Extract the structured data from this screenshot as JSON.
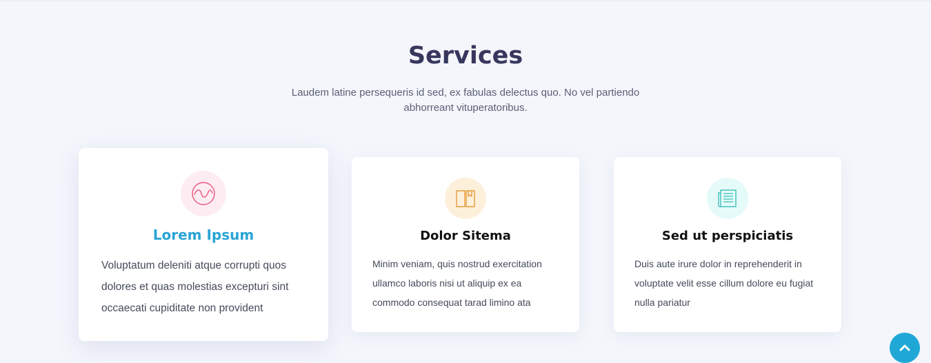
{
  "services": {
    "title": "Services",
    "subtitle": "Laudem latine persequeris id sed, ex fabulas delectus quo. No vel partiendo abhorreant vituperatoribus."
  },
  "cards": [
    {
      "icon": "wave-icon",
      "title": "Lorem Ipsum",
      "text": "Voluptatum deleniti atque corrupti quos dolores et quas molestias excepturi sint occaecati cupiditate non provident",
      "accent": "#2aa4d5",
      "icon_color": "#e8577f",
      "icon_bg": "#fdecf2"
    },
    {
      "icon": "book-icon",
      "title": "Dolor Sitema",
      "text": "Minim veniam, quis nostrud exercitation ullamco laboris nisi ut aliquip ex ea commodo consequat tarad limino ata",
      "accent": "#111111",
      "icon_color": "#e69a3a",
      "icon_bg": "#fdf0db"
    },
    {
      "icon": "document-icon",
      "title": "Sed ut perspiciatis",
      "text": "Duis aute irure dolor in reprehenderit in voluptate velit esse cillum dolore eu fugiat nulla pariatur",
      "accent": "#111111",
      "icon_color": "#3fbfb7",
      "icon_bg": "#e4fbfa"
    }
  ],
  "scroll_top": {
    "icon": "chevron-up-icon",
    "color": "#1fa8d6"
  }
}
